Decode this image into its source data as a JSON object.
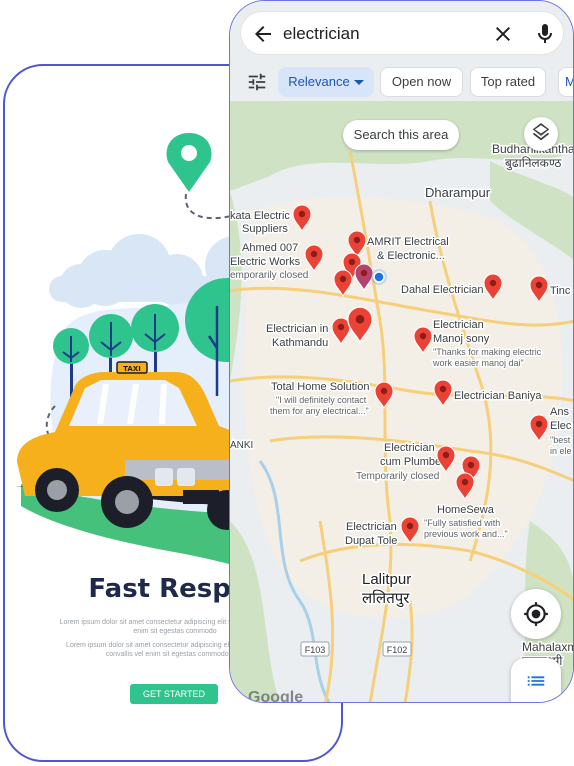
{
  "back_screen": {
    "title": "Fast Respor",
    "lorem_1": "Lorem ipsum dolor sit amet consectetur adipiscing elit sapien, convallis vel enim sit egestas commodo",
    "lorem_2": "Lorem ipsum dolor sit amet consectetur adipiscing elit Duis elit sapien, convallis vel enim sit egestas commodo arcu",
    "cta_label": "GET STARTED",
    "taxi_sign": "TAXI",
    "colors": {
      "accent": "#2fc48d",
      "taxi": "#f5b01c",
      "frame": "#4f55d6",
      "title": "#1e2a4a"
    },
    "icons": [
      "location-pin-icon"
    ]
  },
  "maps": {
    "search": {
      "query": "electrician",
      "icons": [
        "back-arrow-icon",
        "close-icon",
        "mic-icon"
      ]
    },
    "filters": {
      "icon": "tune-icon",
      "chips": [
        {
          "label": "Relevance",
          "selected": true
        },
        {
          "label": "Open now",
          "selected": false
        },
        {
          "label": "Top rated",
          "selected": false
        },
        {
          "label": "M",
          "selected": false
        }
      ]
    },
    "search_area_label": "Search this area",
    "map_labels": {
      "budhanilkantha": "Budhanilkantha",
      "budhanilkantha_np": "बुढानिलकण्ठ",
      "dharampur": "Dharampur",
      "lalitpur": "Lalitpur",
      "lalitpur_np": "ललितपुर",
      "mahalaxmi": "Mahalaxmi",
      "mahalaxmi_np": "महालक्ष्मी",
      "anki": "ANKI",
      "road_f103": "F103",
      "road_f102": "F102"
    },
    "places": [
      {
        "name_1": "kata Electric",
        "name_2": "Suppliers"
      },
      {
        "name_1": "Ahmed 007",
        "name_2": "Electric Works",
        "note": "emporarily closed"
      },
      {
        "name_1": "AMRIT Electrical",
        "name_2": "& Electronic..."
      },
      {
        "name_1": "Dahal Electrician"
      },
      {
        "name_1": "Tinc"
      },
      {
        "name_1": "Electrician in",
        "name_2": "Kathmandu"
      },
      {
        "name_1": "Electrician",
        "name_2": "Manoj sony",
        "review_1": "\"Thanks for making electric",
        "review_2": "work easier manoj dai\""
      },
      {
        "name_1": "Total Home Solution",
        "review_1": "\"I will definitely contact",
        "review_2": "them for any electrical...\""
      },
      {
        "name_1": "Electrician Baniya"
      },
      {
        "name_1": "Ans",
        "name_2": "Elec",
        "review_1": "\"best",
        "review_2": "in ele"
      },
      {
        "name_1": "Electrician",
        "name_2": "cum Plumber",
        "note": "Temporarily closed"
      },
      {
        "name_1": "HomeSewa",
        "review_1": "\"Fully satisfied with",
        "review_2": "previous work and...\""
      },
      {
        "name_1": "Electrician",
        "name_2": "Dupat Tole"
      }
    ],
    "buttons": {
      "layers_icon": "layers-icon",
      "locate_icon": "my-location-icon",
      "list_icon": "list-icon"
    },
    "logo": "Google",
    "colors": {
      "pin": "#ea4335",
      "chip_selected_bg": "#d8e5f8",
      "chip_selected_text": "#1a56b8",
      "my_location": "#1a73e8"
    }
  }
}
